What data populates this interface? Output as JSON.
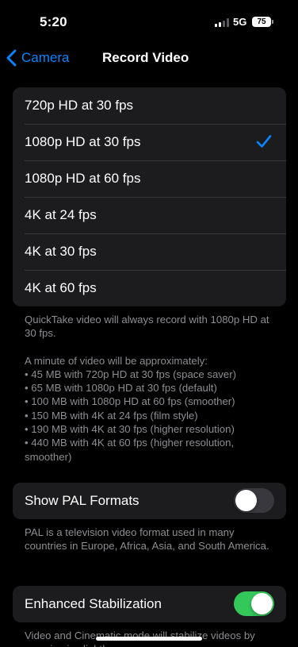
{
  "status_bar": {
    "time": "5:20",
    "network": "5G",
    "battery": "75"
  },
  "nav": {
    "back_label": "Camera",
    "title": "Record Video"
  },
  "resolution_options": [
    {
      "label": "720p HD at 30 fps",
      "selected": false
    },
    {
      "label": "1080p HD at 30 fps",
      "selected": true
    },
    {
      "label": "1080p HD at 60 fps",
      "selected": false
    },
    {
      "label": "4K at 24 fps",
      "selected": false
    },
    {
      "label": "4K at 30 fps",
      "selected": false
    },
    {
      "label": "4K at 60 fps",
      "selected": false
    }
  ],
  "resolution_footer": {
    "quicktake_note": "QuickTake video will always record with 1080p HD at 30 fps.",
    "minute_intro": "A minute of video will be approximately:",
    "sizes": [
      "• 45 MB with 720p HD at 30 fps (space saver)",
      "• 65 MB with 1080p HD at 30 fps (default)",
      "• 100 MB with 1080p HD at 60 fps (smoother)",
      "• 150 MB with 4K at 24 fps (film style)",
      "• 190 MB with 4K at 30 fps (higher resolution)",
      "• 440 MB with 4K at 60 fps (higher resolution, smoother)"
    ]
  },
  "pal": {
    "label": "Show PAL Formats",
    "enabled": false,
    "footer": "PAL is a television video format used in many countries in Europe, Africa, Asia, and South America."
  },
  "stabilization": {
    "label": "Enhanced Stabilization",
    "enabled": true,
    "footer": "Video and Cinematic mode will stabilize videos by zooming in slightly."
  },
  "colors": {
    "accent": "#0a84ff",
    "toggle_on": "#34c759",
    "cell_background": "#1c1c1e",
    "secondary_text": "#8d8d92"
  },
  "icons": {
    "back": "chevron-left-icon",
    "selected": "checkmark-icon"
  }
}
